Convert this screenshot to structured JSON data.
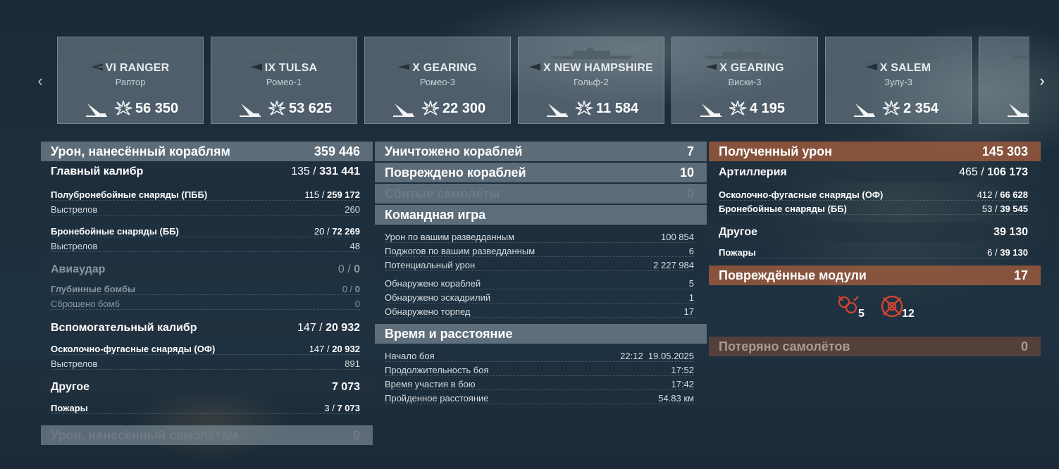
{
  "carousel": {
    "cards": [
      {
        "tier": "VI",
        "ship": "RANGER",
        "player": "Раптор",
        "damage": "56 350"
      },
      {
        "tier": "IX",
        "ship": "TULSA",
        "player": "Ромео-1",
        "damage": "53 625"
      },
      {
        "tier": "X",
        "ship": "GEARING",
        "player": "Ромео-3",
        "damage": "22 300"
      },
      {
        "tier": "X",
        "ship": "NEW HAMPSHIRE",
        "player": "Гольф-2",
        "damage": "11 584"
      },
      {
        "tier": "X",
        "ship": "GEARING",
        "player": "Виски-3",
        "damage": "4 195"
      },
      {
        "tier": "X",
        "ship": "SALEM",
        "player": "Зулу-3",
        "damage": "2 354"
      }
    ]
  },
  "left": {
    "header": {
      "label": "Урон, нанесённый кораблям",
      "value": "359 446"
    },
    "main_caliber": {
      "label": "Главный калибр",
      "hits": "135",
      "value": "331 441"
    },
    "ap": {
      "label": "Полубронебойные снаряды (ПББ)",
      "hits": "115",
      "value": "259 172"
    },
    "ap_shots": {
      "label": "Выстрелов",
      "value": "260"
    },
    "apb": {
      "label": "Бронебойные снаряды (ББ)",
      "hits": "20",
      "value": "72 269"
    },
    "apb_shots": {
      "label": "Выстрелов",
      "value": "48"
    },
    "airstrike": {
      "label": "Авиаудар",
      "hits": "0",
      "value": "0"
    },
    "depth": {
      "label": "Глубинные бомбы",
      "hits": "0",
      "value": "0"
    },
    "bombs": {
      "label": "Сброшено бомб",
      "value": "0"
    },
    "secondary": {
      "label": "Вспомогательный калибр",
      "hits": "147",
      "value": "20 932"
    },
    "he": {
      "label": "Осколочно-фугасные снаряды (ОФ)",
      "hits": "147",
      "value": "20 932"
    },
    "he_shots": {
      "label": "Выстрелов",
      "value": "891"
    },
    "other": {
      "label": "Другое",
      "value": "7 073"
    },
    "fires": {
      "label": "Пожары",
      "hits": "3",
      "value": "7 073"
    },
    "aircraft": {
      "label": "Урон, нанесённый самолётам",
      "value": "0"
    }
  },
  "middle": {
    "destroyed": {
      "label": "Уничтожено кораблей",
      "value": "7"
    },
    "damaged": {
      "label": "Повреждено кораблей",
      "value": "10"
    },
    "planes": {
      "label": "Сбитые самолёты",
      "value": "0"
    },
    "team": {
      "label": "Командная игра"
    },
    "team_rows": [
      {
        "label": "Урон по вашим разведданным",
        "value": "100 854"
      },
      {
        "label": "Поджогов по вашим разведданным",
        "value": "6"
      },
      {
        "label": "Потенциальный урон",
        "value": "2 227 984"
      },
      {
        "label": "Обнаружено кораблей",
        "value": "5"
      },
      {
        "label": "Обнаружено эскадрилий",
        "value": "1"
      },
      {
        "label": "Обнаружено торпед",
        "value": "17"
      }
    ],
    "time": {
      "label": "Время и расстояние"
    },
    "time_rows": [
      {
        "label": "Начало боя",
        "value": "22:12  19.05.2025"
      },
      {
        "label": "Продолжительность боя",
        "value": "17:52"
      },
      {
        "label": "Время участия в бою",
        "value": "17:42"
      },
      {
        "label": "Пройденное расстояние",
        "value": "54.83 км"
      }
    ]
  },
  "right": {
    "received": {
      "label": "Полученный урон",
      "value": "145 303"
    },
    "artillery": {
      "label": "Артиллерия",
      "hits": "465",
      "value": "106 173"
    },
    "he": {
      "label": "Осколочно-фугасные снаряды (ОФ)",
      "hits": "412",
      "value": "66 628"
    },
    "ap": {
      "label": "Бронебойные снаряды (ББ)",
      "hits": "53",
      "value": "39 545"
    },
    "other": {
      "label": "Другое",
      "value": "39 130"
    },
    "fires": {
      "label": "Пожары",
      "hits": "6",
      "value": "39 130"
    },
    "modules": {
      "label": "Повреждённые модули",
      "value": "17"
    },
    "module_counts": {
      "turret": "5",
      "steering": "12"
    },
    "planes_lost": {
      "label": "Потеряно самолётов",
      "value": "0"
    }
  },
  "colors": {
    "header": "#8f9eaa",
    "orange": "#a85f3c",
    "module_icon": "#d0442e"
  }
}
